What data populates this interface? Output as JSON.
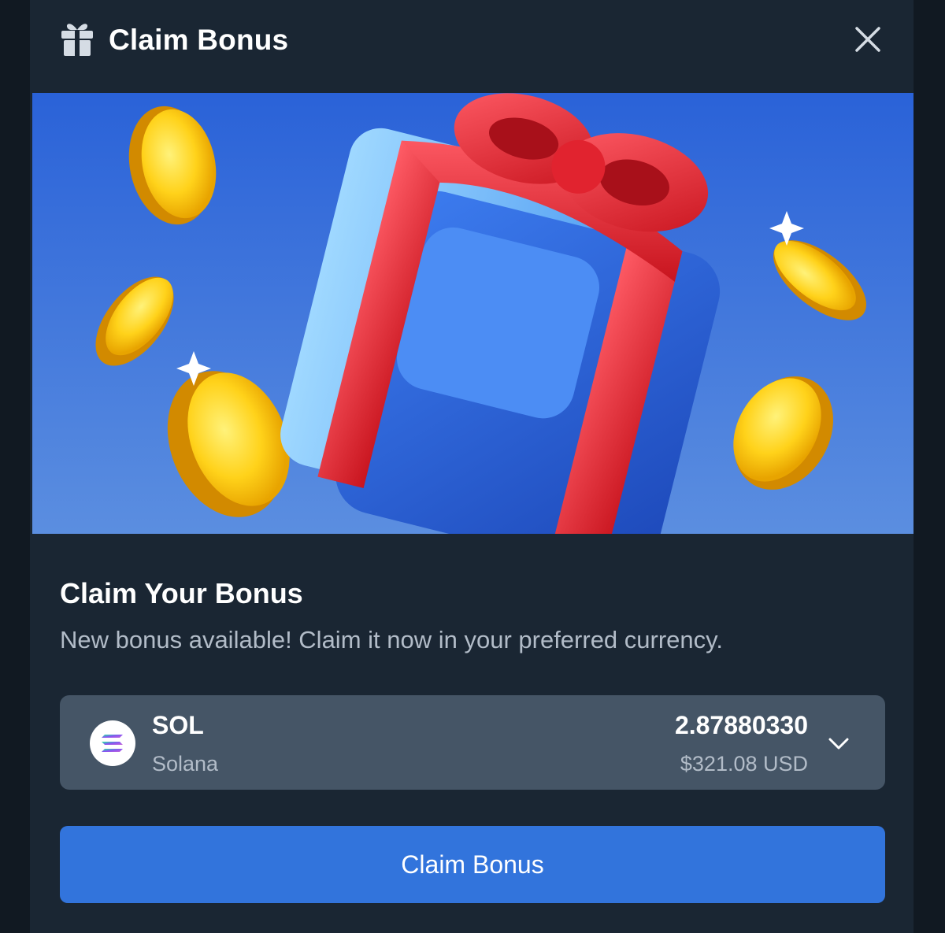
{
  "header": {
    "title": "Claim Bonus",
    "icon": "gift-icon",
    "close_icon": "close-icon"
  },
  "banner": {
    "image": "gift-box-with-coins"
  },
  "content": {
    "heading": "Claim Your Bonus",
    "description": "New bonus available! Claim it now in your preferred currency."
  },
  "currency_select": {
    "symbol": "SOL",
    "name": "Solana",
    "amount": "2.87880330",
    "usd_value": "$321.08 USD",
    "icon": "solana-icon",
    "chevron": "chevron-down-icon"
  },
  "cta": {
    "label": "Claim Bonus"
  },
  "colors": {
    "background": "#1a2633",
    "select_bg": "#455566",
    "accent": "#3274dc",
    "text_primary": "#ffffff",
    "text_secondary": "#b2bcc8"
  }
}
